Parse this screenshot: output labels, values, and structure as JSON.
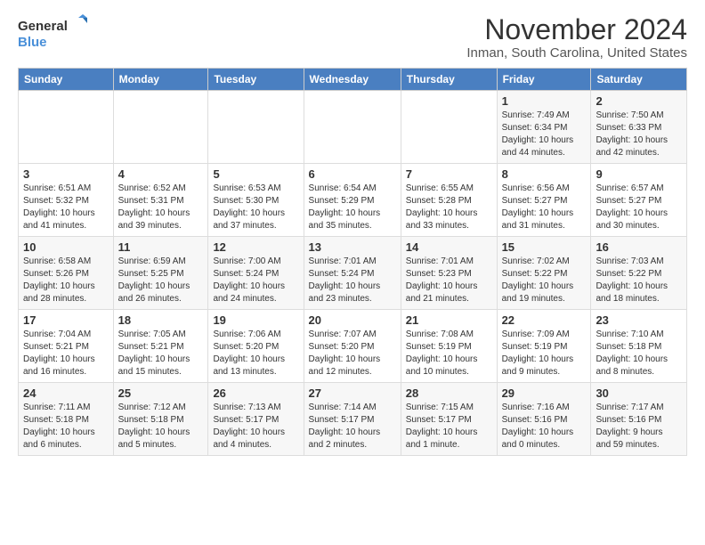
{
  "logo": {
    "line1": "General",
    "line2": "Blue"
  },
  "title": "November 2024",
  "location": "Inman, South Carolina, United States",
  "days_header": [
    "Sunday",
    "Monday",
    "Tuesday",
    "Wednesday",
    "Thursday",
    "Friday",
    "Saturday"
  ],
  "weeks": [
    [
      {
        "day": "",
        "info": ""
      },
      {
        "day": "",
        "info": ""
      },
      {
        "day": "",
        "info": ""
      },
      {
        "day": "",
        "info": ""
      },
      {
        "day": "",
        "info": ""
      },
      {
        "day": "1",
        "info": "Sunrise: 7:49 AM\nSunset: 6:34 PM\nDaylight: 10 hours\nand 44 minutes."
      },
      {
        "day": "2",
        "info": "Sunrise: 7:50 AM\nSunset: 6:33 PM\nDaylight: 10 hours\nand 42 minutes."
      }
    ],
    [
      {
        "day": "3",
        "info": "Sunrise: 6:51 AM\nSunset: 5:32 PM\nDaylight: 10 hours\nand 41 minutes."
      },
      {
        "day": "4",
        "info": "Sunrise: 6:52 AM\nSunset: 5:31 PM\nDaylight: 10 hours\nand 39 minutes."
      },
      {
        "day": "5",
        "info": "Sunrise: 6:53 AM\nSunset: 5:30 PM\nDaylight: 10 hours\nand 37 minutes."
      },
      {
        "day": "6",
        "info": "Sunrise: 6:54 AM\nSunset: 5:29 PM\nDaylight: 10 hours\nand 35 minutes."
      },
      {
        "day": "7",
        "info": "Sunrise: 6:55 AM\nSunset: 5:28 PM\nDaylight: 10 hours\nand 33 minutes."
      },
      {
        "day": "8",
        "info": "Sunrise: 6:56 AM\nSunset: 5:27 PM\nDaylight: 10 hours\nand 31 minutes."
      },
      {
        "day": "9",
        "info": "Sunrise: 6:57 AM\nSunset: 5:27 PM\nDaylight: 10 hours\nand 30 minutes."
      }
    ],
    [
      {
        "day": "10",
        "info": "Sunrise: 6:58 AM\nSunset: 5:26 PM\nDaylight: 10 hours\nand 28 minutes."
      },
      {
        "day": "11",
        "info": "Sunrise: 6:59 AM\nSunset: 5:25 PM\nDaylight: 10 hours\nand 26 minutes."
      },
      {
        "day": "12",
        "info": "Sunrise: 7:00 AM\nSunset: 5:24 PM\nDaylight: 10 hours\nand 24 minutes."
      },
      {
        "day": "13",
        "info": "Sunrise: 7:01 AM\nSunset: 5:24 PM\nDaylight: 10 hours\nand 23 minutes."
      },
      {
        "day": "14",
        "info": "Sunrise: 7:01 AM\nSunset: 5:23 PM\nDaylight: 10 hours\nand 21 minutes."
      },
      {
        "day": "15",
        "info": "Sunrise: 7:02 AM\nSunset: 5:22 PM\nDaylight: 10 hours\nand 19 minutes."
      },
      {
        "day": "16",
        "info": "Sunrise: 7:03 AM\nSunset: 5:22 PM\nDaylight: 10 hours\nand 18 minutes."
      }
    ],
    [
      {
        "day": "17",
        "info": "Sunrise: 7:04 AM\nSunset: 5:21 PM\nDaylight: 10 hours\nand 16 minutes."
      },
      {
        "day": "18",
        "info": "Sunrise: 7:05 AM\nSunset: 5:21 PM\nDaylight: 10 hours\nand 15 minutes."
      },
      {
        "day": "19",
        "info": "Sunrise: 7:06 AM\nSunset: 5:20 PM\nDaylight: 10 hours\nand 13 minutes."
      },
      {
        "day": "20",
        "info": "Sunrise: 7:07 AM\nSunset: 5:20 PM\nDaylight: 10 hours\nand 12 minutes."
      },
      {
        "day": "21",
        "info": "Sunrise: 7:08 AM\nSunset: 5:19 PM\nDaylight: 10 hours\nand 10 minutes."
      },
      {
        "day": "22",
        "info": "Sunrise: 7:09 AM\nSunset: 5:19 PM\nDaylight: 10 hours\nand 9 minutes."
      },
      {
        "day": "23",
        "info": "Sunrise: 7:10 AM\nSunset: 5:18 PM\nDaylight: 10 hours\nand 8 minutes."
      }
    ],
    [
      {
        "day": "24",
        "info": "Sunrise: 7:11 AM\nSunset: 5:18 PM\nDaylight: 10 hours\nand 6 minutes."
      },
      {
        "day": "25",
        "info": "Sunrise: 7:12 AM\nSunset: 5:18 PM\nDaylight: 10 hours\nand 5 minutes."
      },
      {
        "day": "26",
        "info": "Sunrise: 7:13 AM\nSunset: 5:17 PM\nDaylight: 10 hours\nand 4 minutes."
      },
      {
        "day": "27",
        "info": "Sunrise: 7:14 AM\nSunset: 5:17 PM\nDaylight: 10 hours\nand 2 minutes."
      },
      {
        "day": "28",
        "info": "Sunrise: 7:15 AM\nSunset: 5:17 PM\nDaylight: 10 hours\nand 1 minute."
      },
      {
        "day": "29",
        "info": "Sunrise: 7:16 AM\nSunset: 5:16 PM\nDaylight: 10 hours\nand 0 minutes."
      },
      {
        "day": "30",
        "info": "Sunrise: 7:17 AM\nSunset: 5:16 PM\nDaylight: 9 hours\nand 59 minutes."
      }
    ]
  ]
}
